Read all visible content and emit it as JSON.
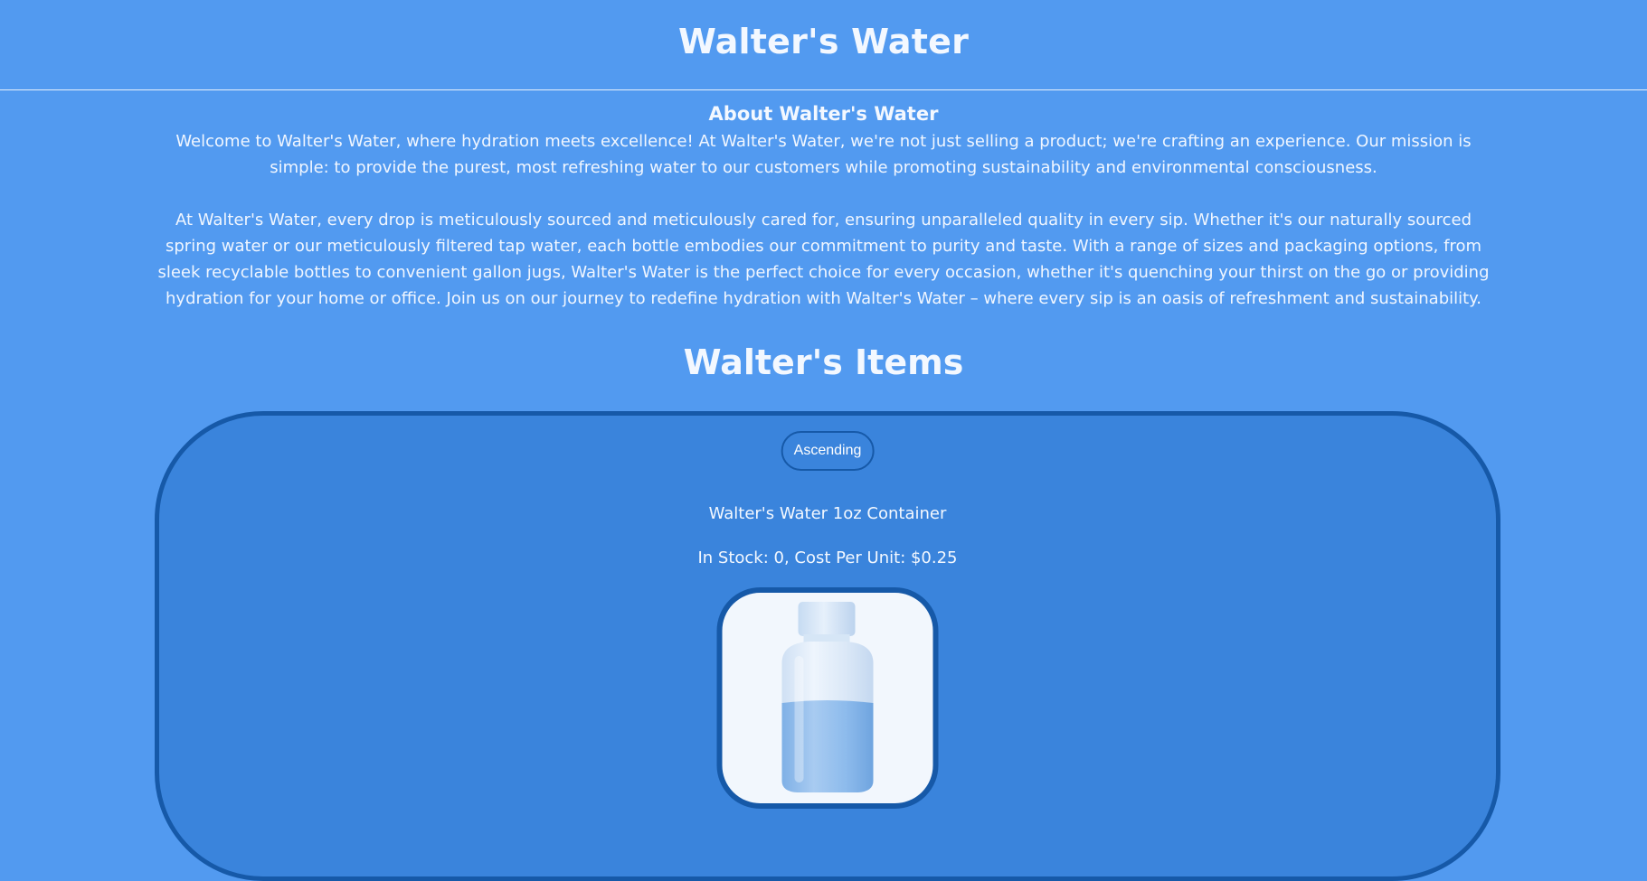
{
  "header": {
    "title": "Walter's Water"
  },
  "about": {
    "title": "About Walter's Water",
    "paragraph1": "Welcome to Walter's Water, where hydration meets excellence! At Walter's Water, we're not just selling a product; we're crafting an experience. Our mission is simple: to provide the purest, most refreshing water to our customers while promoting sustainability and environmental consciousness.",
    "paragraph2": "At Walter's Water, every drop is meticulously sourced and meticulously cared for, ensuring unparalleled quality in every sip. Whether it's our naturally sourced spring water or our meticulously filtered tap water, each bottle embodies our commitment to purity and taste. With a range of sizes and packaging options, from sleek recyclable bottles to convenient gallon jugs, Walter's Water is the perfect choice for every occasion, whether it's quenching your thirst on the go or providing hydration for your home or office. Join us on our journey to redefine hydration with Walter's Water – where every sip is an oasis of refreshment and sustainability."
  },
  "items": {
    "title": "Walter's Items",
    "sort_button_label": "Ascending",
    "list": [
      {
        "name": "Walter's Water 1oz Container",
        "meta": "In Stock: 0, Cost Per Unit: $0.25",
        "image_icon": "water-bottle-image"
      }
    ]
  },
  "colors": {
    "page_background": "#529af0",
    "panel_background": "#3a84dc",
    "panel_border": "#1659a8",
    "text": "#ffffff"
  }
}
